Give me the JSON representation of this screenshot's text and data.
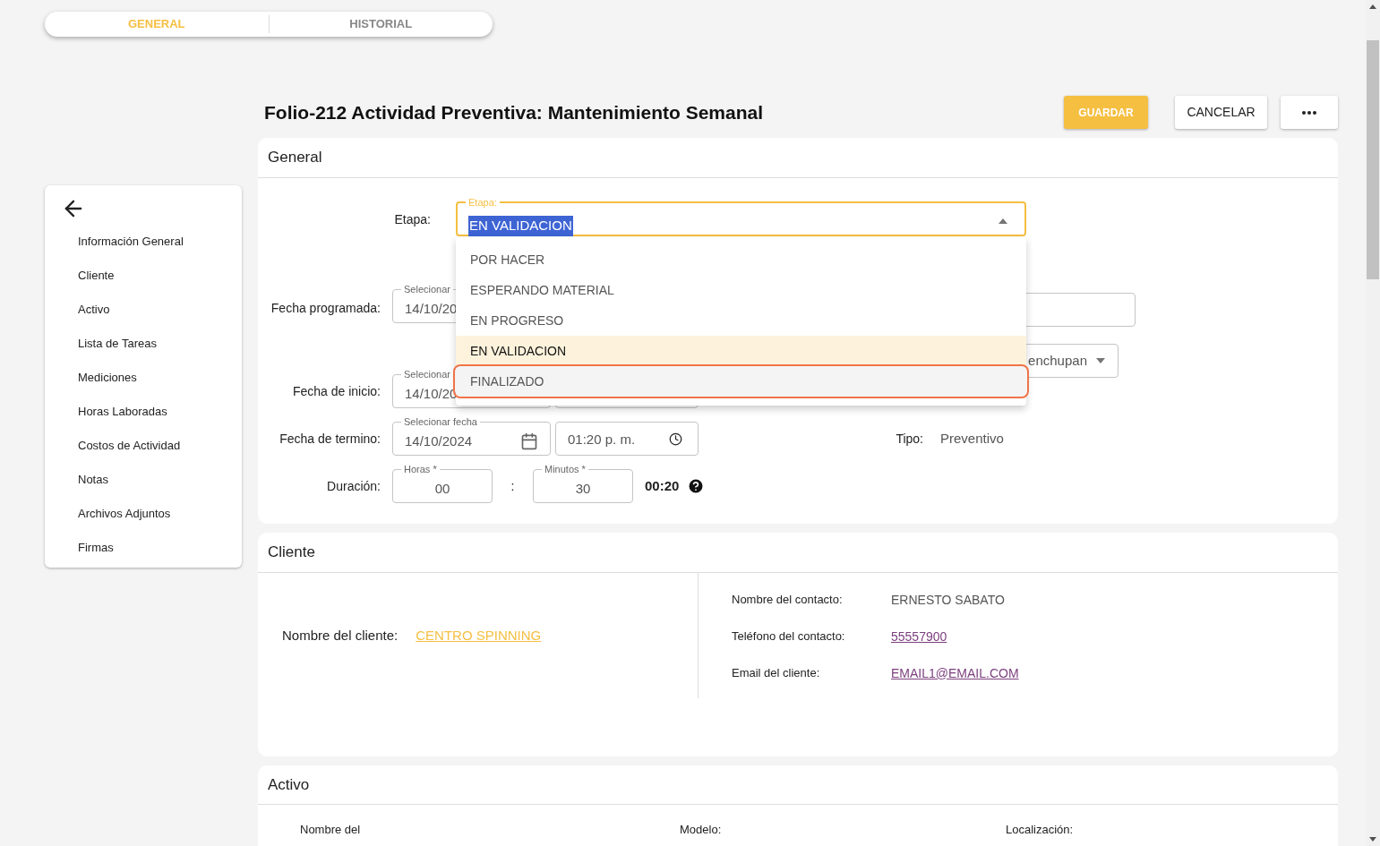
{
  "tabs": [
    {
      "label": "GENERAL",
      "selected": true
    },
    {
      "label": "HISTORIAL",
      "selected": false
    }
  ],
  "sidebar": {
    "items": [
      {
        "label": "Información General"
      },
      {
        "label": "Cliente"
      },
      {
        "label": "Activo"
      },
      {
        "label": "Lista de Tareas"
      },
      {
        "label": "Mediciones"
      },
      {
        "label": "Horas Laboradas"
      },
      {
        "label": "Costos de Actividad"
      },
      {
        "label": "Notas"
      },
      {
        "label": "Archivos Adjuntos"
      },
      {
        "label": "Firmas"
      }
    ]
  },
  "header": {
    "title": "Folio-212 Actividad Preventiva: Mantenimiento Semanal",
    "buttons": [
      {
        "label": "GUARDAR",
        "kind": "primary"
      },
      {
        "label": "CANCELAR",
        "kind": "secondary"
      },
      {
        "kind": "more"
      }
    ]
  },
  "general": {
    "title": "General",
    "etapa": {
      "label": "Etapa:",
      "field_label": "Etapa:",
      "value": "EN VALIDACION",
      "expanded": true,
      "options": [
        {
          "label": "POR HACER",
          "selected": false,
          "highlighted": false
        },
        {
          "label": "ESPERANDO MATERIAL",
          "selected": false,
          "highlighted": false
        },
        {
          "label": "EN PROGRESO",
          "selected": false,
          "highlighted": false
        },
        {
          "label": "EN VALIDACION",
          "selected": true,
          "highlighted": false
        },
        {
          "label": "FINALIZADO",
          "selected": false,
          "highlighted": true
        }
      ]
    },
    "fecha_programada": {
      "label": "Fecha programada:",
      "field_label": "Selecionar",
      "value": "14/10/20"
    },
    "partial_select": {
      "value": "enchupan"
    },
    "fecha_inicio": {
      "label": "Fecha de inicio:",
      "field_label": "Selecionar",
      "value": "14/10/20"
    },
    "fecha_termino": {
      "label": "Fecha de termino:",
      "field_label": "Selecionar fecha",
      "date": "14/10/2024",
      "time": "01:20 p. m."
    },
    "duracion": {
      "label": "Duración:",
      "hours_label": "Horas *",
      "hours": "00",
      "separator": ":",
      "minutes_label": "Minutos *",
      "minutes": "30",
      "total": "00:20"
    },
    "tipo": {
      "label": "Tipo:",
      "value": "Preventivo"
    }
  },
  "cliente": {
    "title": "Cliente",
    "client_label": "Nombre del cliente:",
    "client_value": "CENTRO SPINNING",
    "contact": [
      {
        "label": "Nombre del contacto:",
        "value": "ERNESTO SABATO",
        "kind": "text"
      },
      {
        "label": "Teléfono del contacto:",
        "value": "55557900",
        "kind": "link"
      },
      {
        "label": "Email del cliente:",
        "value": "EMAIL1@EMAIL.COM",
        "kind": "link"
      }
    ]
  },
  "activo": {
    "title": "Activo",
    "labels": [
      "Nombre del",
      "Modelo:",
      "Localización:"
    ]
  }
}
